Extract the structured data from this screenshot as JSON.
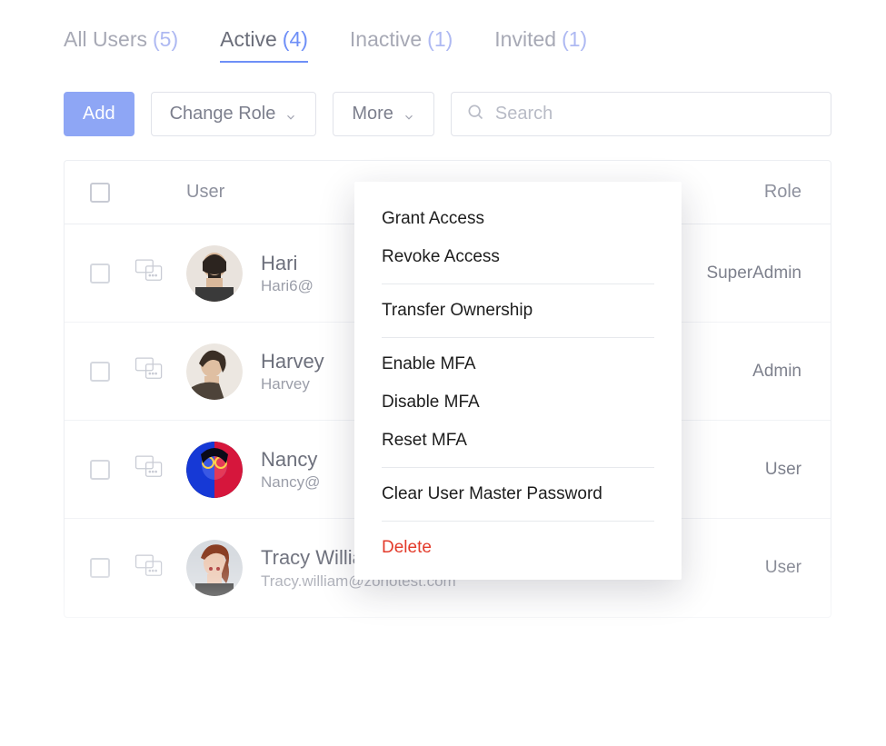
{
  "tabs": [
    {
      "label": "All Users",
      "count": "(5)",
      "active": false
    },
    {
      "label": "Active",
      "count": "(4)",
      "active": true
    },
    {
      "label": "Inactive",
      "count": "(1)",
      "active": false
    },
    {
      "label": "Invited",
      "count": "(1)",
      "active": false
    }
  ],
  "toolbar": {
    "add_label": "Add",
    "change_role_label": "Change Role",
    "more_label": "More",
    "search_placeholder": "Search"
  },
  "table": {
    "headers": {
      "user": "User",
      "role": "Role"
    },
    "rows": [
      {
        "name": "Hari",
        "email": "Hari6@",
        "role": "SuperAdmin"
      },
      {
        "name": "Harvey",
        "email": "Harvey",
        "role": "Admin"
      },
      {
        "name": "Nancy",
        "email": "Nancy@",
        "role": "User"
      },
      {
        "name": "Tracy William",
        "email": "Tracy.william@zohotest.com",
        "role": "User"
      }
    ]
  },
  "menu": {
    "groups": [
      [
        "Grant Access",
        "Revoke Access"
      ],
      [
        "Transfer Ownership"
      ],
      [
        "Enable MFA",
        "Disable MFA",
        "Reset MFA"
      ],
      [
        "Clear User Master Password"
      ]
    ],
    "delete_label": "Delete"
  }
}
